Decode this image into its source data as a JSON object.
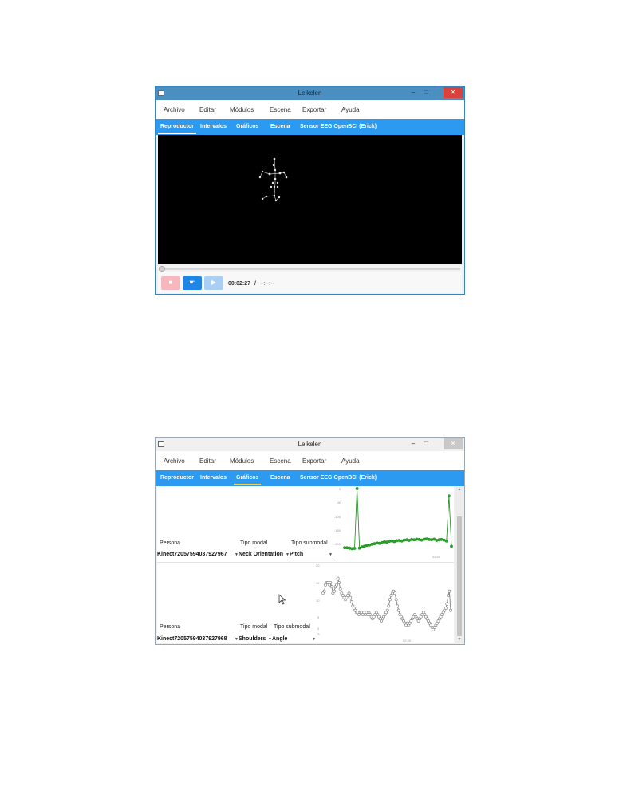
{
  "window1": {
    "title": "Leikelen",
    "controls": {
      "minimize": "–",
      "maximize": "□",
      "close": "✕"
    },
    "menu": [
      "Archivo",
      "Editar",
      "Módulos",
      "Escena",
      "Exportar",
      "Ayuda"
    ],
    "tabs": [
      "Reproductor",
      "Intervalos",
      "Gráficos",
      "Escena",
      "Sensor EEG OpenBCI (Erick)"
    ],
    "active_tab": "Reproductor",
    "player": {
      "current_time": "00:02:27",
      "separator": "/",
      "total_time": "--:--:--",
      "record_icon": "stop-square-icon",
      "play_icon": "play-icon",
      "forward_icon": "next-icon"
    }
  },
  "window2": {
    "title": "Leikelen",
    "controls": {
      "minimize": "–",
      "maximize": "□",
      "close": "✕"
    },
    "menu": [
      "Archivo",
      "Editar",
      "Módulos",
      "Escena",
      "Exportar",
      "Ayuda"
    ],
    "tabs": [
      "Reproductor",
      "Intervalos",
      "Gráficos",
      "Escena",
      "Sensor EEG OpenBCI (Erick)"
    ],
    "active_tab": "Gráficos",
    "graphs": [
      {
        "labels": {
          "persona": "Persona",
          "tipo_modal": "Tipo modal",
          "tipo_submodal": "Tipo submodal"
        },
        "values": {
          "persona": "Kinect72057594037927967",
          "tipo_modal": "Neck Orientation",
          "tipo_submodal": "Pitch"
        },
        "color": "#1a8a1a",
        "y_ticks": [
          "0",
          "-50",
          "-100",
          "-150",
          "-200"
        ],
        "x_tick": "02:40"
      },
      {
        "labels": {
          "persona": "Persona",
          "tipo_modal": "Tipo modal",
          "tipo_submodal": "Tipo submodal"
        },
        "values": {
          "persona": "Kinect72057594037927968",
          "tipo_modal": "Shoulders",
          "tipo_submodal": "Angle"
        },
        "color": "#777777",
        "y_ticks": [
          "20",
          "15",
          "10",
          "5",
          "0",
          "-5"
        ],
        "x_tick": "02:40"
      }
    ]
  },
  "chart_data": [
    {
      "type": "line",
      "series": [
        {
          "values": [
            -195,
            -195,
            -196,
            -198,
            -197,
            5,
            -196,
            -192,
            -190,
            -187,
            -186,
            -183,
            -181,
            -179,
            -180,
            -177,
            -175,
            -176,
            -173,
            -172,
            -174,
            -171,
            -170,
            -172,
            -169,
            -168,
            -170,
            -167,
            -168,
            -166,
            -167,
            -169,
            -166,
            -165,
            -167,
            -168,
            -166,
            -170,
            -168,
            -167,
            -169,
            -172,
            -20,
            -190
          ]
        }
      ],
      "ylim": [
        -205,
        5
      ]
    },
    {
      "type": "line",
      "series": [
        {
          "values": [
            11,
            12,
            15,
            16,
            16,
            15,
            16,
            14,
            11,
            12,
            14,
            15,
            18,
            16,
            13,
            11,
            10,
            9,
            8,
            9,
            10,
            11,
            9,
            7,
            5,
            4,
            3,
            2,
            2,
            1,
            2,
            2,
            1,
            2,
            1,
            2,
            1,
            2,
            1,
            0,
            -1,
            0,
            1,
            2,
            1,
            0,
            -1,
            -2,
            -1,
            0,
            1,
            2,
            3,
            5,
            8,
            10,
            11,
            12,
            11,
            8,
            5,
            3,
            1,
            0,
            -1,
            -2,
            -3,
            -4,
            -3,
            -4,
            -3,
            -2,
            -1,
            0,
            1,
            0,
            -1,
            -2,
            -1,
            0,
            1,
            2,
            1,
            0,
            -1,
            -2,
            -3,
            -4,
            -5,
            -6,
            -5,
            -4,
            -3,
            -2,
            -1,
            0,
            1,
            2,
            3,
            4,
            6,
            10,
            12,
            3
          ]
        }
      ],
      "ylim": [
        -8,
        22
      ]
    }
  ]
}
